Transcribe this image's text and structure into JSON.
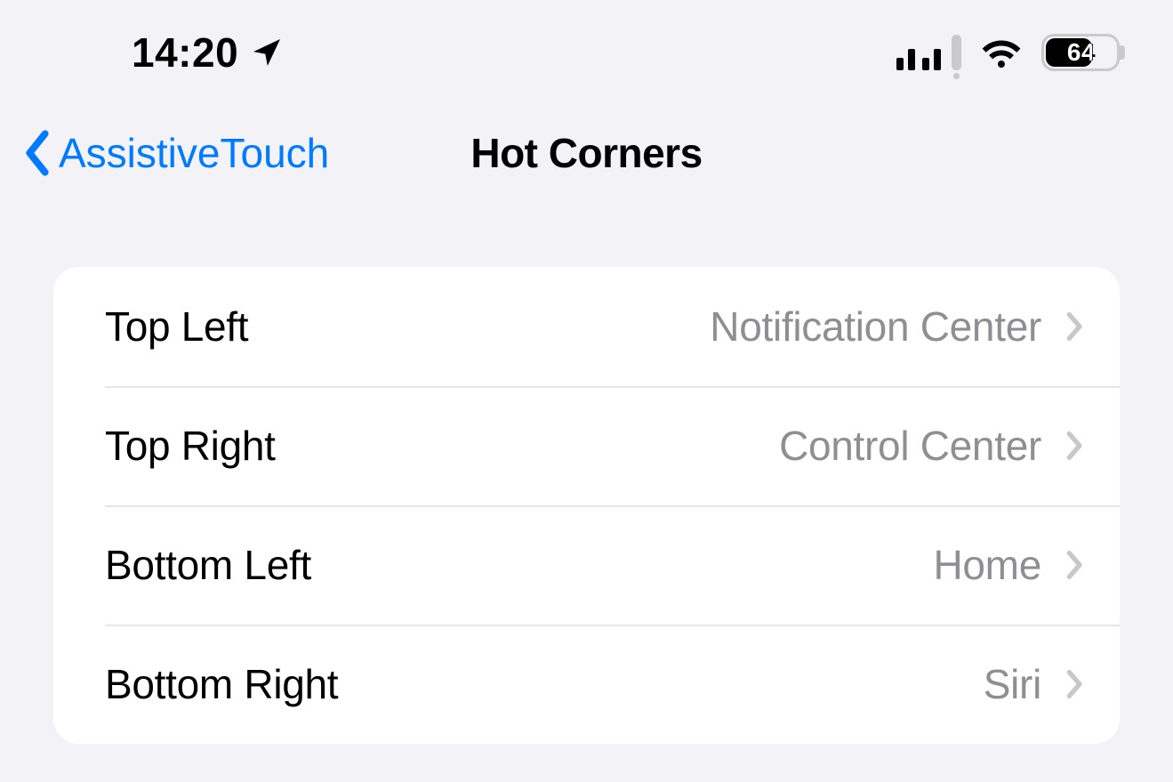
{
  "status": {
    "time": "14:20",
    "battery_percent": "64"
  },
  "nav": {
    "back_label": "AssistiveTouch",
    "title": "Hot Corners"
  },
  "rows": [
    {
      "label": "Top Left",
      "value": "Notification Center"
    },
    {
      "label": "Top Right",
      "value": "Control Center"
    },
    {
      "label": "Bottom Left",
      "value": "Home"
    },
    {
      "label": "Bottom Right",
      "value": "Siri"
    }
  ]
}
